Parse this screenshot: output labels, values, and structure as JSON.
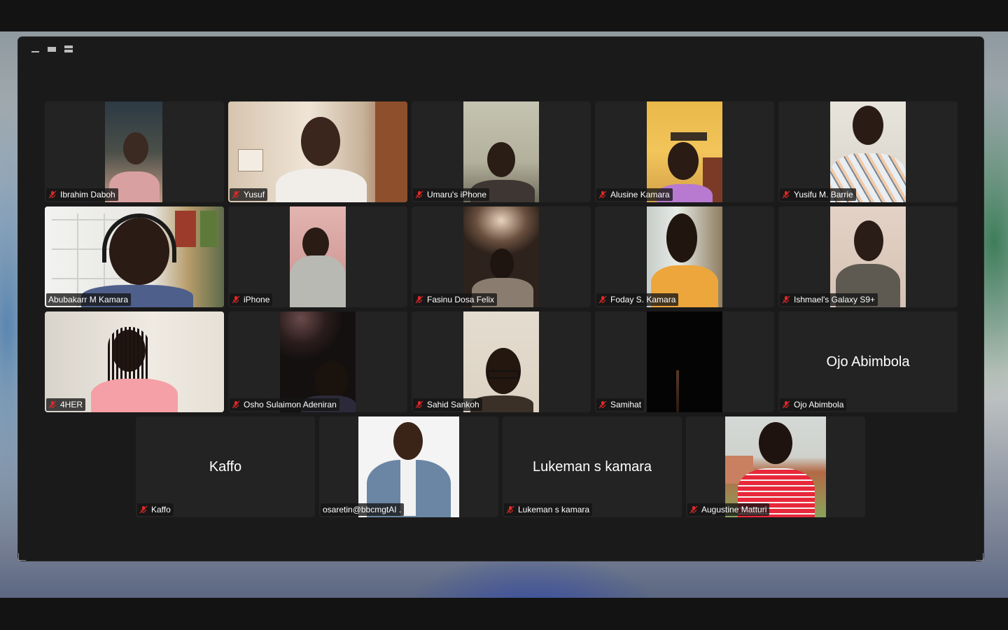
{
  "colors": {
    "window_bg": "#1a1a1a",
    "tile_bg": "#232323",
    "active_speaker_border": "#23d14a",
    "muted_icon": "#e02828",
    "gallery_icon": "#4a8cf7"
  },
  "view_controls": [
    "minimize-icon",
    "speaker-view-icon",
    "strip-view-icon",
    "gallery-view-icon"
  ],
  "participants": [
    {
      "name": "Ibrahim Daboh",
      "muted": true,
      "video": true
    },
    {
      "name": "Yusuf",
      "muted": true,
      "video": true
    },
    {
      "name": "Umaru's iPhone",
      "muted": true,
      "video": true
    },
    {
      "name": "Alusine Kamara",
      "muted": true,
      "video": true
    },
    {
      "name": "Yusifu M. Barrie",
      "muted": true,
      "video": true
    },
    {
      "name": "Abubakarr M Kamara",
      "muted": false,
      "video": true,
      "active_speaker": true
    },
    {
      "name": "iPhone",
      "muted": true,
      "video": true
    },
    {
      "name": "Fasinu Dosa Felix",
      "muted": true,
      "video": true
    },
    {
      "name": "Foday S. Kamara",
      "muted": true,
      "video": true
    },
    {
      "name": "Ishmael's Galaxy S9+",
      "muted": true,
      "video": true
    },
    {
      "name": "4HER",
      "muted": true,
      "video": true
    },
    {
      "name": "Osho Sulaimon Adeniran",
      "muted": true,
      "video": true
    },
    {
      "name": "Sahid Sankoh",
      "muted": true,
      "video": true
    },
    {
      "name": "Samihat",
      "muted": true,
      "video": true
    },
    {
      "name": "Ojo Abimbola",
      "muted": true,
      "video": false,
      "display_name": "Ojo Abimbola"
    },
    {
      "name": "Kaffo",
      "muted": true,
      "video": false,
      "display_name": "Kaffo"
    },
    {
      "name": "osaretin@bbcmgtAI .",
      "muted": false,
      "video": true
    },
    {
      "name": "Lukeman s kamara",
      "muted": true,
      "video": false,
      "display_name": "Lukeman s kamara"
    },
    {
      "name": "Augustine Matturi",
      "muted": true,
      "video": true
    }
  ]
}
